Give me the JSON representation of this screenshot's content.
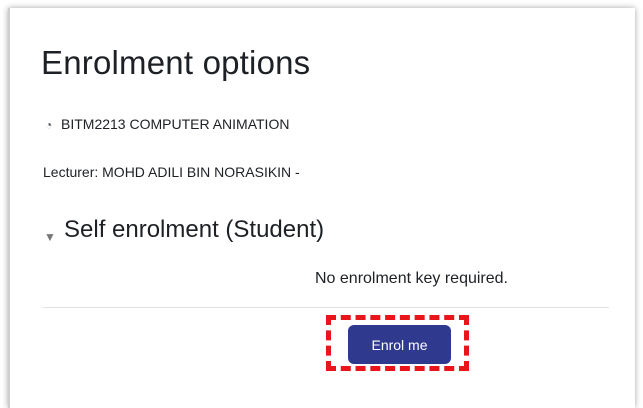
{
  "page": {
    "title": "Enrolment options"
  },
  "course": {
    "icon": "course-icon",
    "name": "BITM2213 COMPUTER ANIMATION",
    "lecturer": "Lecturer: MOHD ADILI BIN NORASIKIN -"
  },
  "enrolment": {
    "section_icon": "chevron-down-icon",
    "method_title": "Self enrolment (Student)",
    "key_info": "No enrolment key required.",
    "button_label": "Enrol me"
  },
  "colors": {
    "button_bg": "#2f3a8f",
    "highlight": "#e8161b",
    "text": "#1d2125"
  }
}
